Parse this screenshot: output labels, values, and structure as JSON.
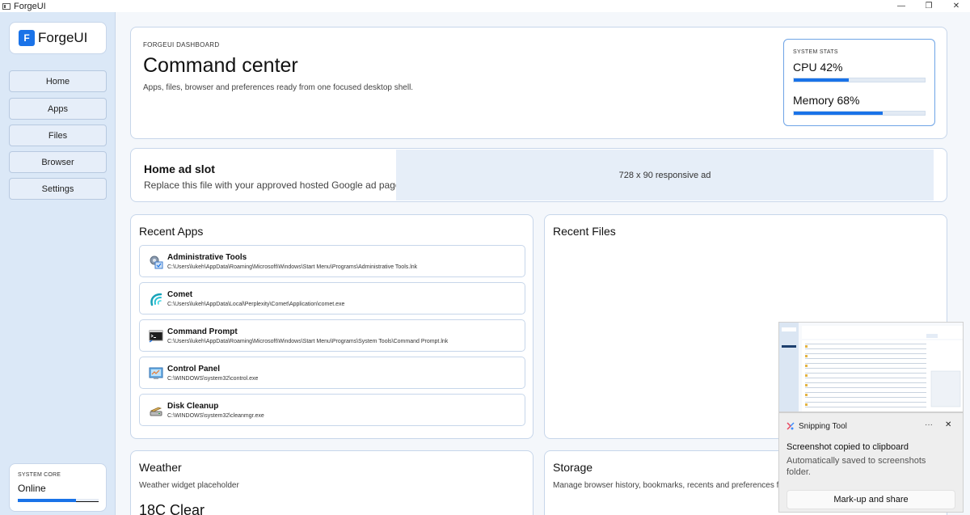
{
  "window": {
    "title": "ForgeUI",
    "controls": {
      "minimize": "—",
      "restore": "❐",
      "close": "✕"
    }
  },
  "sidebar": {
    "brand_badge": "F",
    "brand_name": "ForgeUI",
    "nav": [
      {
        "label": "Home"
      },
      {
        "label": "Apps"
      },
      {
        "label": "Files"
      },
      {
        "label": "Browser"
      },
      {
        "label": "Settings"
      }
    ],
    "core": {
      "label": "SYSTEM CORE",
      "status": "Online",
      "progress_fraction": 0.72
    }
  },
  "hero": {
    "eyebrow": "FORGEUI DASHBOARD",
    "title": "Command center",
    "subtitle": "Apps, files, browser and preferences ready from one focused desktop shell.",
    "stats": {
      "label": "SYSTEM STATS",
      "cpu_text": "CPU 42%",
      "cpu_percent": 42,
      "memory_text": "Memory 68%",
      "memory_percent": 68
    }
  },
  "ad": {
    "title": "Home ad slot",
    "subtitle": "Replace this file with your approved hosted Google ad page.",
    "slot_text": "728 x 90 responsive ad"
  },
  "recent_apps": {
    "title": "Recent Apps",
    "items": [
      {
        "name": "Administrative Tools",
        "path": "C:\\Users\\lukeh\\AppData\\Roaming\\Microsoft\\Windows\\Start Menu\\Programs\\Administrative Tools.lnk",
        "icon": "admin-tools-icon"
      },
      {
        "name": "Comet",
        "path": "C:\\Users\\lukeh\\AppData\\Local\\Perplexity\\Comet\\Application\\comet.exe",
        "icon": "comet-icon"
      },
      {
        "name": "Command Prompt",
        "path": "C:\\Users\\lukeh\\AppData\\Roaming\\Microsoft\\Windows\\Start Menu\\Programs\\System Tools\\Command Prompt.lnk",
        "icon": "command-prompt-icon"
      },
      {
        "name": "Control Panel",
        "path": "C:\\WINDOWS\\system32\\control.exe",
        "icon": "control-panel-icon"
      },
      {
        "name": "Disk Cleanup",
        "path": "C:\\WINDOWS\\system32\\cleanmgr.exe",
        "icon": "disk-cleanup-icon"
      }
    ]
  },
  "recent_files": {
    "title": "Recent Files"
  },
  "weather": {
    "title": "Weather",
    "subtitle": "Weather widget placeholder",
    "reading": "18C  Clear"
  },
  "storage": {
    "title": "Storage",
    "subtitle": "Manage browser history, bookmarks, recents and preferences fr"
  },
  "toast": {
    "app_name": "Snipping Tool",
    "more": "···",
    "close": "✕",
    "title": "Screenshot copied to clipboard",
    "body": "Automatically saved to screenshots folder.",
    "action": "Mark-up and share"
  },
  "colors": {
    "accent": "#1a73e8",
    "sidebar_bg": "#dbe8f7",
    "page_bg": "#f4f7fb",
    "card_border": "#c7d6ea"
  }
}
